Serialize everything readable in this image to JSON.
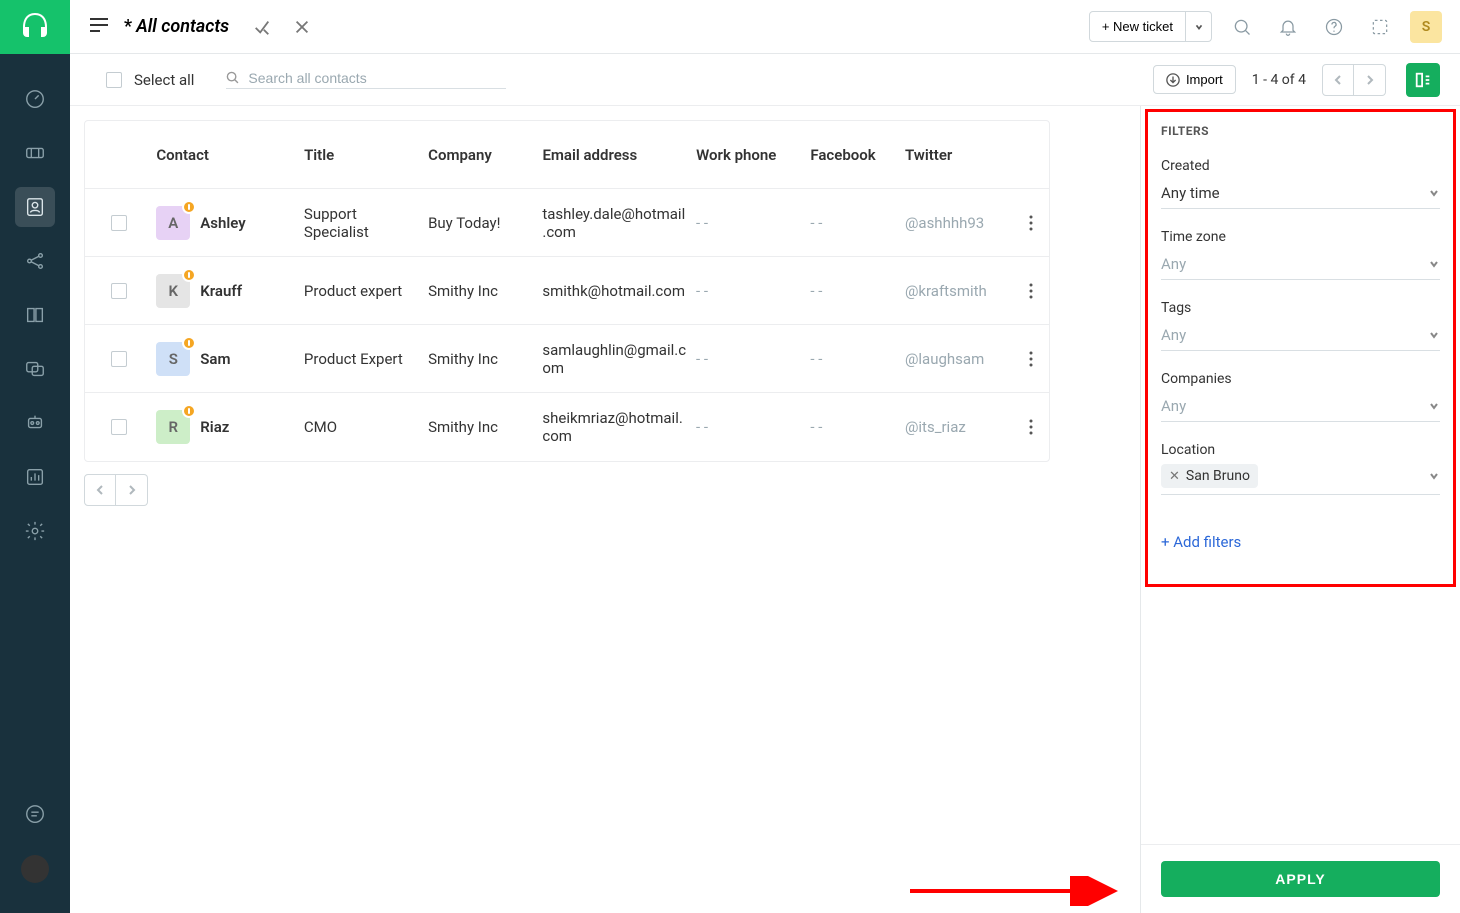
{
  "header": {
    "page_title_prefix": "*",
    "page_title": "All contacts",
    "new_ticket_label": "+ New ticket",
    "user_initial": "S"
  },
  "toolbar": {
    "select_all_label": "Select all",
    "search_placeholder": "Search all contacts",
    "import_label": "Import",
    "paging_text": "1 - 4 of 4"
  },
  "table": {
    "columns": {
      "contact": "Contact",
      "title": "Title",
      "company": "Company",
      "email": "Email address",
      "work_phone": "Work phone",
      "facebook": "Facebook",
      "twitter": "Twitter"
    },
    "rows": [
      {
        "initial": "A",
        "avatar_bg": "#e7d2f5",
        "name": "Ashley",
        "title": "Support Specialist",
        "company": "Buy Today!",
        "email": "tashley.dale@hotmail.com",
        "work_phone": "- -",
        "facebook": "- -",
        "twitter": "@ashhhh93"
      },
      {
        "initial": "K",
        "avatar_bg": "#e5e5e5",
        "name": "Krauff",
        "title": "Product expert",
        "company": "Smithy Inc",
        "email": "smithk@hotmail.com",
        "work_phone": "- -",
        "facebook": "- -",
        "twitter": "@kraftsmith"
      },
      {
        "initial": "S",
        "avatar_bg": "#cfe0f7",
        "name": "Sam",
        "title": "Product Expert",
        "company": "Smithy Inc",
        "email": "samlaughlin@gmail.com",
        "work_phone": "- -",
        "facebook": "- -",
        "twitter": "@laughsam"
      },
      {
        "initial": "R",
        "avatar_bg": "#cdeec8",
        "name": "Riaz",
        "title": "CMO",
        "company": "Smithy Inc",
        "email": "sheikmriaz@hotmail.com",
        "work_phone": "- -",
        "facebook": "- -",
        "twitter": "@its_riaz"
      }
    ]
  },
  "filters": {
    "title": "FILTERS",
    "created": {
      "label": "Created",
      "value": "Any time"
    },
    "timezone": {
      "label": "Time zone",
      "placeholder": "Any"
    },
    "tags": {
      "label": "Tags",
      "placeholder": "Any"
    },
    "companies": {
      "label": "Companies",
      "placeholder": "Any"
    },
    "location": {
      "label": "Location",
      "chip": "San Bruno"
    },
    "add_filters": "+ Add filters",
    "apply": "APPLY"
  }
}
